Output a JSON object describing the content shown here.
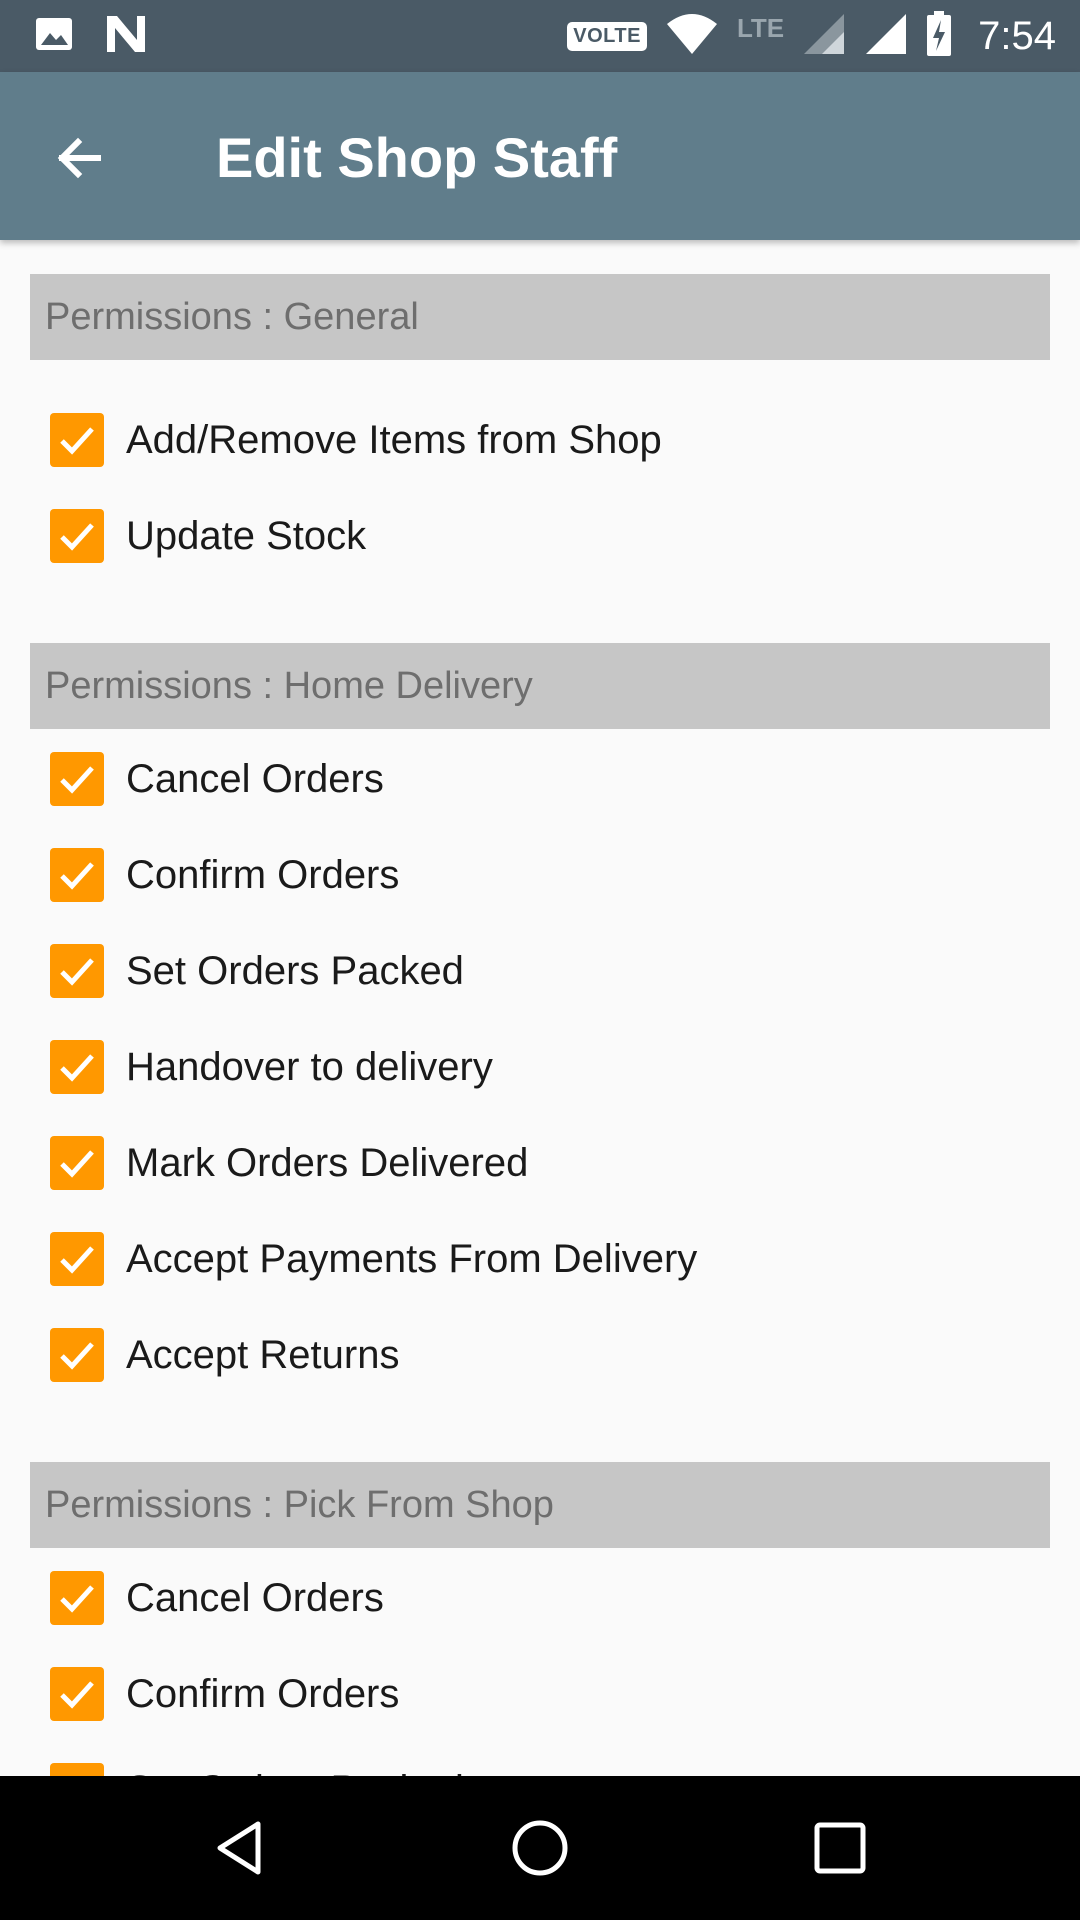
{
  "status_bar": {
    "volte": "VOLTE",
    "network": "LTE",
    "time": "7:54"
  },
  "app_bar": {
    "title": "Edit Shop Staff"
  },
  "sections": {
    "general": {
      "header": "Permissions : General",
      "items": [
        {
          "label": "Add/Remove Items from Shop",
          "checked": true
        },
        {
          "label": "Update Stock",
          "checked": true
        }
      ]
    },
    "home_delivery": {
      "header": "Permissions : Home Delivery",
      "items": [
        {
          "label": "Cancel Orders",
          "checked": true
        },
        {
          "label": "Confirm Orders",
          "checked": true
        },
        {
          "label": "Set Orders Packed",
          "checked": true
        },
        {
          "label": "Handover to delivery",
          "checked": true
        },
        {
          "label": "Mark Orders Delivered",
          "checked": true
        },
        {
          "label": "Accept Payments From Delivery",
          "checked": true
        },
        {
          "label": "Accept Returns",
          "checked": true
        }
      ]
    },
    "pick_from_shop": {
      "header": "Permissions : Pick From Shop",
      "items": [
        {
          "label": "Cancel Orders",
          "checked": true
        },
        {
          "label": "Confirm Orders",
          "checked": true
        },
        {
          "label": "Set Orders Packed",
          "checked": true
        }
      ]
    }
  },
  "colors": {
    "status_bar": "#4a5a66",
    "app_bar": "#607d8b",
    "checkbox": "#ff9800",
    "section_header_bg": "#c6c6c6",
    "section_header_text": "#6e6e6e",
    "background": "#fafafa"
  },
  "icons": {
    "status_left": [
      "image-icon",
      "n-notification-icon"
    ],
    "status_right": [
      "volte-icon",
      "wifi-icon",
      "lte-signal-icon",
      "signal-icon",
      "battery-charging-icon"
    ],
    "app_bar": "arrow-back-icon",
    "nav": [
      "nav-back-icon",
      "nav-home-icon",
      "nav-recents-icon"
    ]
  }
}
